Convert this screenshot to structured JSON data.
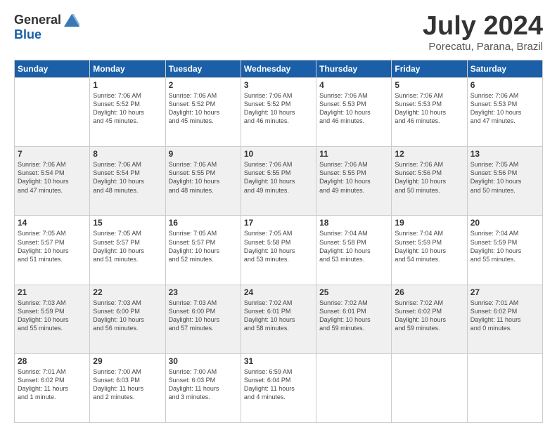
{
  "header": {
    "logo_general": "General",
    "logo_blue": "Blue",
    "month_year": "July 2024",
    "location": "Porecatu, Parana, Brazil"
  },
  "weekdays": [
    "Sunday",
    "Monday",
    "Tuesday",
    "Wednesday",
    "Thursday",
    "Friday",
    "Saturday"
  ],
  "weeks": [
    [
      {
        "day": "",
        "info": ""
      },
      {
        "day": "1",
        "info": "Sunrise: 7:06 AM\nSunset: 5:52 PM\nDaylight: 10 hours\nand 45 minutes."
      },
      {
        "day": "2",
        "info": "Sunrise: 7:06 AM\nSunset: 5:52 PM\nDaylight: 10 hours\nand 45 minutes."
      },
      {
        "day": "3",
        "info": "Sunrise: 7:06 AM\nSunset: 5:52 PM\nDaylight: 10 hours\nand 46 minutes."
      },
      {
        "day": "4",
        "info": "Sunrise: 7:06 AM\nSunset: 5:53 PM\nDaylight: 10 hours\nand 46 minutes."
      },
      {
        "day": "5",
        "info": "Sunrise: 7:06 AM\nSunset: 5:53 PM\nDaylight: 10 hours\nand 46 minutes."
      },
      {
        "day": "6",
        "info": "Sunrise: 7:06 AM\nSunset: 5:53 PM\nDaylight: 10 hours\nand 47 minutes."
      }
    ],
    [
      {
        "day": "7",
        "info": "Sunrise: 7:06 AM\nSunset: 5:54 PM\nDaylight: 10 hours\nand 47 minutes."
      },
      {
        "day": "8",
        "info": "Sunrise: 7:06 AM\nSunset: 5:54 PM\nDaylight: 10 hours\nand 48 minutes."
      },
      {
        "day": "9",
        "info": "Sunrise: 7:06 AM\nSunset: 5:55 PM\nDaylight: 10 hours\nand 48 minutes."
      },
      {
        "day": "10",
        "info": "Sunrise: 7:06 AM\nSunset: 5:55 PM\nDaylight: 10 hours\nand 49 minutes."
      },
      {
        "day": "11",
        "info": "Sunrise: 7:06 AM\nSunset: 5:55 PM\nDaylight: 10 hours\nand 49 minutes."
      },
      {
        "day": "12",
        "info": "Sunrise: 7:06 AM\nSunset: 5:56 PM\nDaylight: 10 hours\nand 50 minutes."
      },
      {
        "day": "13",
        "info": "Sunrise: 7:05 AM\nSunset: 5:56 PM\nDaylight: 10 hours\nand 50 minutes."
      }
    ],
    [
      {
        "day": "14",
        "info": "Sunrise: 7:05 AM\nSunset: 5:57 PM\nDaylight: 10 hours\nand 51 minutes."
      },
      {
        "day": "15",
        "info": "Sunrise: 7:05 AM\nSunset: 5:57 PM\nDaylight: 10 hours\nand 51 minutes."
      },
      {
        "day": "16",
        "info": "Sunrise: 7:05 AM\nSunset: 5:57 PM\nDaylight: 10 hours\nand 52 minutes."
      },
      {
        "day": "17",
        "info": "Sunrise: 7:05 AM\nSunset: 5:58 PM\nDaylight: 10 hours\nand 53 minutes."
      },
      {
        "day": "18",
        "info": "Sunrise: 7:04 AM\nSunset: 5:58 PM\nDaylight: 10 hours\nand 53 minutes."
      },
      {
        "day": "19",
        "info": "Sunrise: 7:04 AM\nSunset: 5:59 PM\nDaylight: 10 hours\nand 54 minutes."
      },
      {
        "day": "20",
        "info": "Sunrise: 7:04 AM\nSunset: 5:59 PM\nDaylight: 10 hours\nand 55 minutes."
      }
    ],
    [
      {
        "day": "21",
        "info": "Sunrise: 7:03 AM\nSunset: 5:59 PM\nDaylight: 10 hours\nand 55 minutes."
      },
      {
        "day": "22",
        "info": "Sunrise: 7:03 AM\nSunset: 6:00 PM\nDaylight: 10 hours\nand 56 minutes."
      },
      {
        "day": "23",
        "info": "Sunrise: 7:03 AM\nSunset: 6:00 PM\nDaylight: 10 hours\nand 57 minutes."
      },
      {
        "day": "24",
        "info": "Sunrise: 7:02 AM\nSunset: 6:01 PM\nDaylight: 10 hours\nand 58 minutes."
      },
      {
        "day": "25",
        "info": "Sunrise: 7:02 AM\nSunset: 6:01 PM\nDaylight: 10 hours\nand 59 minutes."
      },
      {
        "day": "26",
        "info": "Sunrise: 7:02 AM\nSunset: 6:02 PM\nDaylight: 10 hours\nand 59 minutes."
      },
      {
        "day": "27",
        "info": "Sunrise: 7:01 AM\nSunset: 6:02 PM\nDaylight: 11 hours\nand 0 minutes."
      }
    ],
    [
      {
        "day": "28",
        "info": "Sunrise: 7:01 AM\nSunset: 6:02 PM\nDaylight: 11 hours\nand 1 minute."
      },
      {
        "day": "29",
        "info": "Sunrise: 7:00 AM\nSunset: 6:03 PM\nDaylight: 11 hours\nand 2 minutes."
      },
      {
        "day": "30",
        "info": "Sunrise: 7:00 AM\nSunset: 6:03 PM\nDaylight: 11 hours\nand 3 minutes."
      },
      {
        "day": "31",
        "info": "Sunrise: 6:59 AM\nSunset: 6:04 PM\nDaylight: 11 hours\nand 4 minutes."
      },
      {
        "day": "",
        "info": ""
      },
      {
        "day": "",
        "info": ""
      },
      {
        "day": "",
        "info": ""
      }
    ]
  ]
}
